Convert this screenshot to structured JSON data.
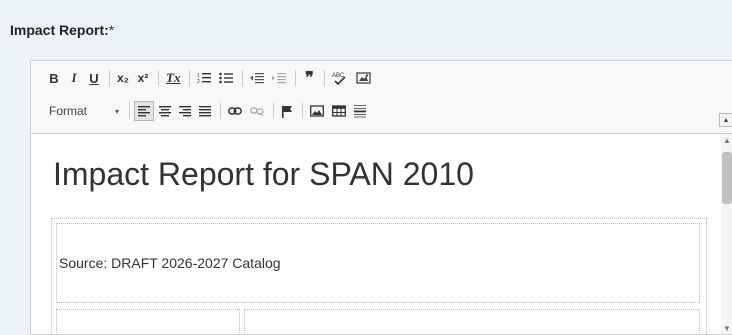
{
  "field": {
    "label": "Impact Report:",
    "required_mark": "*"
  },
  "toolbar": {
    "bold": "B",
    "italic": "I",
    "underline": "U",
    "subscript": "x₂",
    "superscript": "x²",
    "remove_format": "Tx",
    "quote": "❞",
    "format_label": "Format",
    "format_arrow": "▾"
  },
  "icons": [
    "numbered-list-icon",
    "bulleted-list-icon",
    "outdent-icon",
    "indent-icon",
    "spellcheck-icon",
    "image-icon",
    "align-left-icon",
    "align-center-icon",
    "align-right-icon",
    "justify-icon",
    "link-icon",
    "unlink-icon",
    "flag-icon",
    "table-icon",
    "horizontal-rule-icon"
  ],
  "content": {
    "title": "Impact Report for SPAN 2010",
    "source": "Source: DRAFT 2026-2027 Catalog"
  },
  "colors": {
    "background": "#edf4f7",
    "toolbar": "#f8f8f8",
    "text": "#333333"
  }
}
